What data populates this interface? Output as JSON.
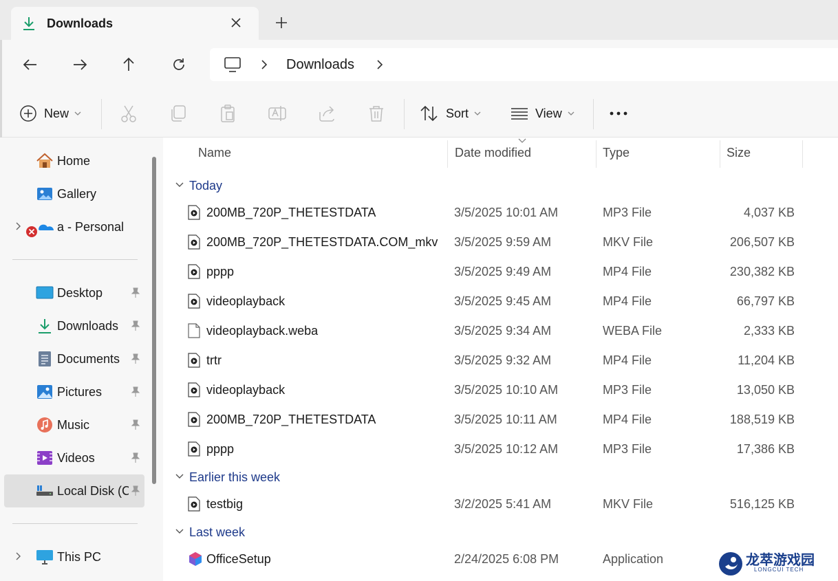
{
  "tab": {
    "title": "Downloads",
    "icon": "download-icon"
  },
  "address": {
    "crumb": "Downloads"
  },
  "toolbar": {
    "new_label": "New",
    "sort_label": "Sort",
    "view_label": "View"
  },
  "sidebar": {
    "top": [
      {
        "label": "Home",
        "icon": "home-icon"
      },
      {
        "label": "Gallery",
        "icon": "gallery-icon"
      },
      {
        "label": "a - Personal",
        "icon": "onedrive-icon"
      }
    ],
    "quick": [
      {
        "label": "Desktop",
        "icon": "desktop-icon"
      },
      {
        "label": "Downloads",
        "icon": "download-icon"
      },
      {
        "label": "Documents",
        "icon": "documents-icon"
      },
      {
        "label": "Pictures",
        "icon": "pictures-icon"
      },
      {
        "label": "Music",
        "icon": "music-icon"
      },
      {
        "label": "Videos",
        "icon": "videos-icon"
      },
      {
        "label": "Local Disk (C:",
        "icon": "drive-icon"
      }
    ],
    "bottom": [
      {
        "label": "This PC",
        "icon": "monitor-icon"
      }
    ]
  },
  "columns": {
    "name": "Name",
    "date": "Date modified",
    "type": "Type",
    "size": "Size"
  },
  "groups": {
    "today": {
      "label": "Today",
      "rows": [
        {
          "name": "200MB_720P_THETESTDATA",
          "date": "3/5/2025 10:01 AM",
          "type": "MP3 File",
          "size": "4,037 KB",
          "icon": "media-file-icon"
        },
        {
          "name": "200MB_720P_THETESTDATA.COM_mkv",
          "date": "3/5/2025 9:59 AM",
          "type": "MKV File",
          "size": "206,507 KB",
          "icon": "media-file-icon"
        },
        {
          "name": "pppp",
          "date": "3/5/2025 9:49 AM",
          "type": "MP4 File",
          "size": "230,382 KB",
          "icon": "media-file-icon"
        },
        {
          "name": "videoplayback",
          "date": "3/5/2025 9:45 AM",
          "type": "MP4 File",
          "size": "66,797 KB",
          "icon": "media-file-icon"
        },
        {
          "name": "videoplayback.weba",
          "date": "3/5/2025 9:34 AM",
          "type": "WEBA File",
          "size": "2,333 KB",
          "icon": "blank-file-icon"
        },
        {
          "name": "trtr",
          "date": "3/5/2025 9:32 AM",
          "type": "MP4 File",
          "size": "11,204 KB",
          "icon": "media-file-icon"
        },
        {
          "name": "videoplayback",
          "date": "3/5/2025 10:10 AM",
          "type": "MP3 File",
          "size": "13,050 KB",
          "icon": "media-file-icon"
        },
        {
          "name": "200MB_720P_THETESTDATA",
          "date": "3/5/2025 10:11 AM",
          "type": "MP4 File",
          "size": "188,519 KB",
          "icon": "media-file-icon"
        },
        {
          "name": "pppp",
          "date": "3/5/2025 10:12 AM",
          "type": "MP3 File",
          "size": "17,386 KB",
          "icon": "media-file-icon"
        }
      ]
    },
    "earlier": {
      "label": "Earlier this week",
      "rows": [
        {
          "name": "testbig",
          "date": "3/2/2025 5:41 AM",
          "type": "MKV File",
          "size": "516,125 KB",
          "icon": "media-file-icon"
        }
      ]
    },
    "lastweek": {
      "label": "Last week",
      "rows": [
        {
          "name": "OfficeSetup",
          "date": "2/24/2025 6:08 PM",
          "type": "Application",
          "size": "",
          "icon": "office-icon"
        }
      ]
    }
  },
  "watermark": {
    "cn": "龙萃游戏园",
    "en": "LONGCUI TECH"
  },
  "colors": {
    "accent": "#0f6cbd",
    "group_label": "#1e3a8a",
    "download_green": "#1b9e6b"
  }
}
